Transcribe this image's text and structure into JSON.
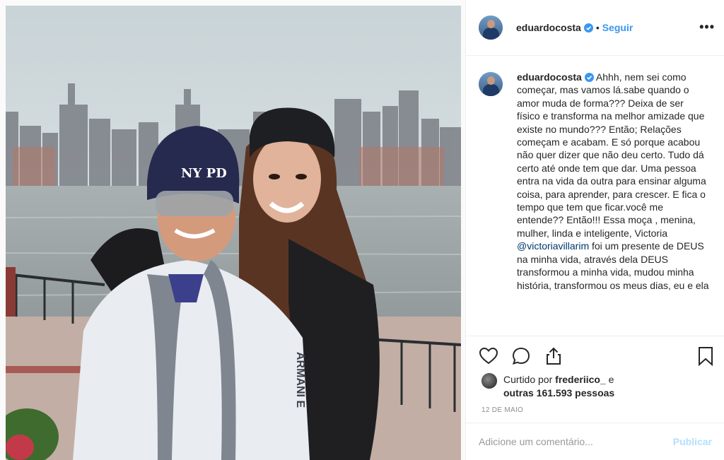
{
  "post": {
    "username": "eduardocosta",
    "follow_label": "Seguir",
    "separator": "•",
    "more_label": "•••",
    "icons": [
      "heart-icon",
      "comment-icon",
      "share-icon",
      "bookmark-icon",
      "verified-badge-icon",
      "more-options-icon"
    ],
    "caption_part1": " Ahhh, nem sei como começar, mas vamos lá.sabe quando o amor muda de forma??? Deixa de ser físico e transforma na melhor amizade que existe no mundo??? Então; Relações começam e acabam. E só porque acabou não quer dizer que não deu certo. Tudo dá certo até onde tem que dar. Uma pessoa entra na vida da outra para ensinar alguma coisa, para aprender, para crescer. E fica o tempo que tem que ficar.você me entende?? Então!!! Essa moça , menina, mulher, linda e inteligente, Victoria ",
    "caption_mention": "@victoriavillarim",
    "caption_part2": " foi um presente de DEUS na minha vida, através dela DEUS transformou a minha vida, mudou minha história, transformou os meus dias, eu e ela",
    "likes_prefix": "Curtido por ",
    "likes_user": "frederiico_",
    "likes_middle": " e",
    "likes_others": "outras 161.593 pessoas",
    "date": "12 DE MAIO",
    "comment_placeholder": "Adicione um comentário...",
    "publish_label": "Publicar",
    "hat_text": "NY PD",
    "jacket_text": "ARMANI E"
  },
  "colors": {
    "link": "#3897f0",
    "publish_disabled": "#b2dffc",
    "mention": "#00376b",
    "muted": "#8e8e8e",
    "verified": "#3897f0"
  }
}
